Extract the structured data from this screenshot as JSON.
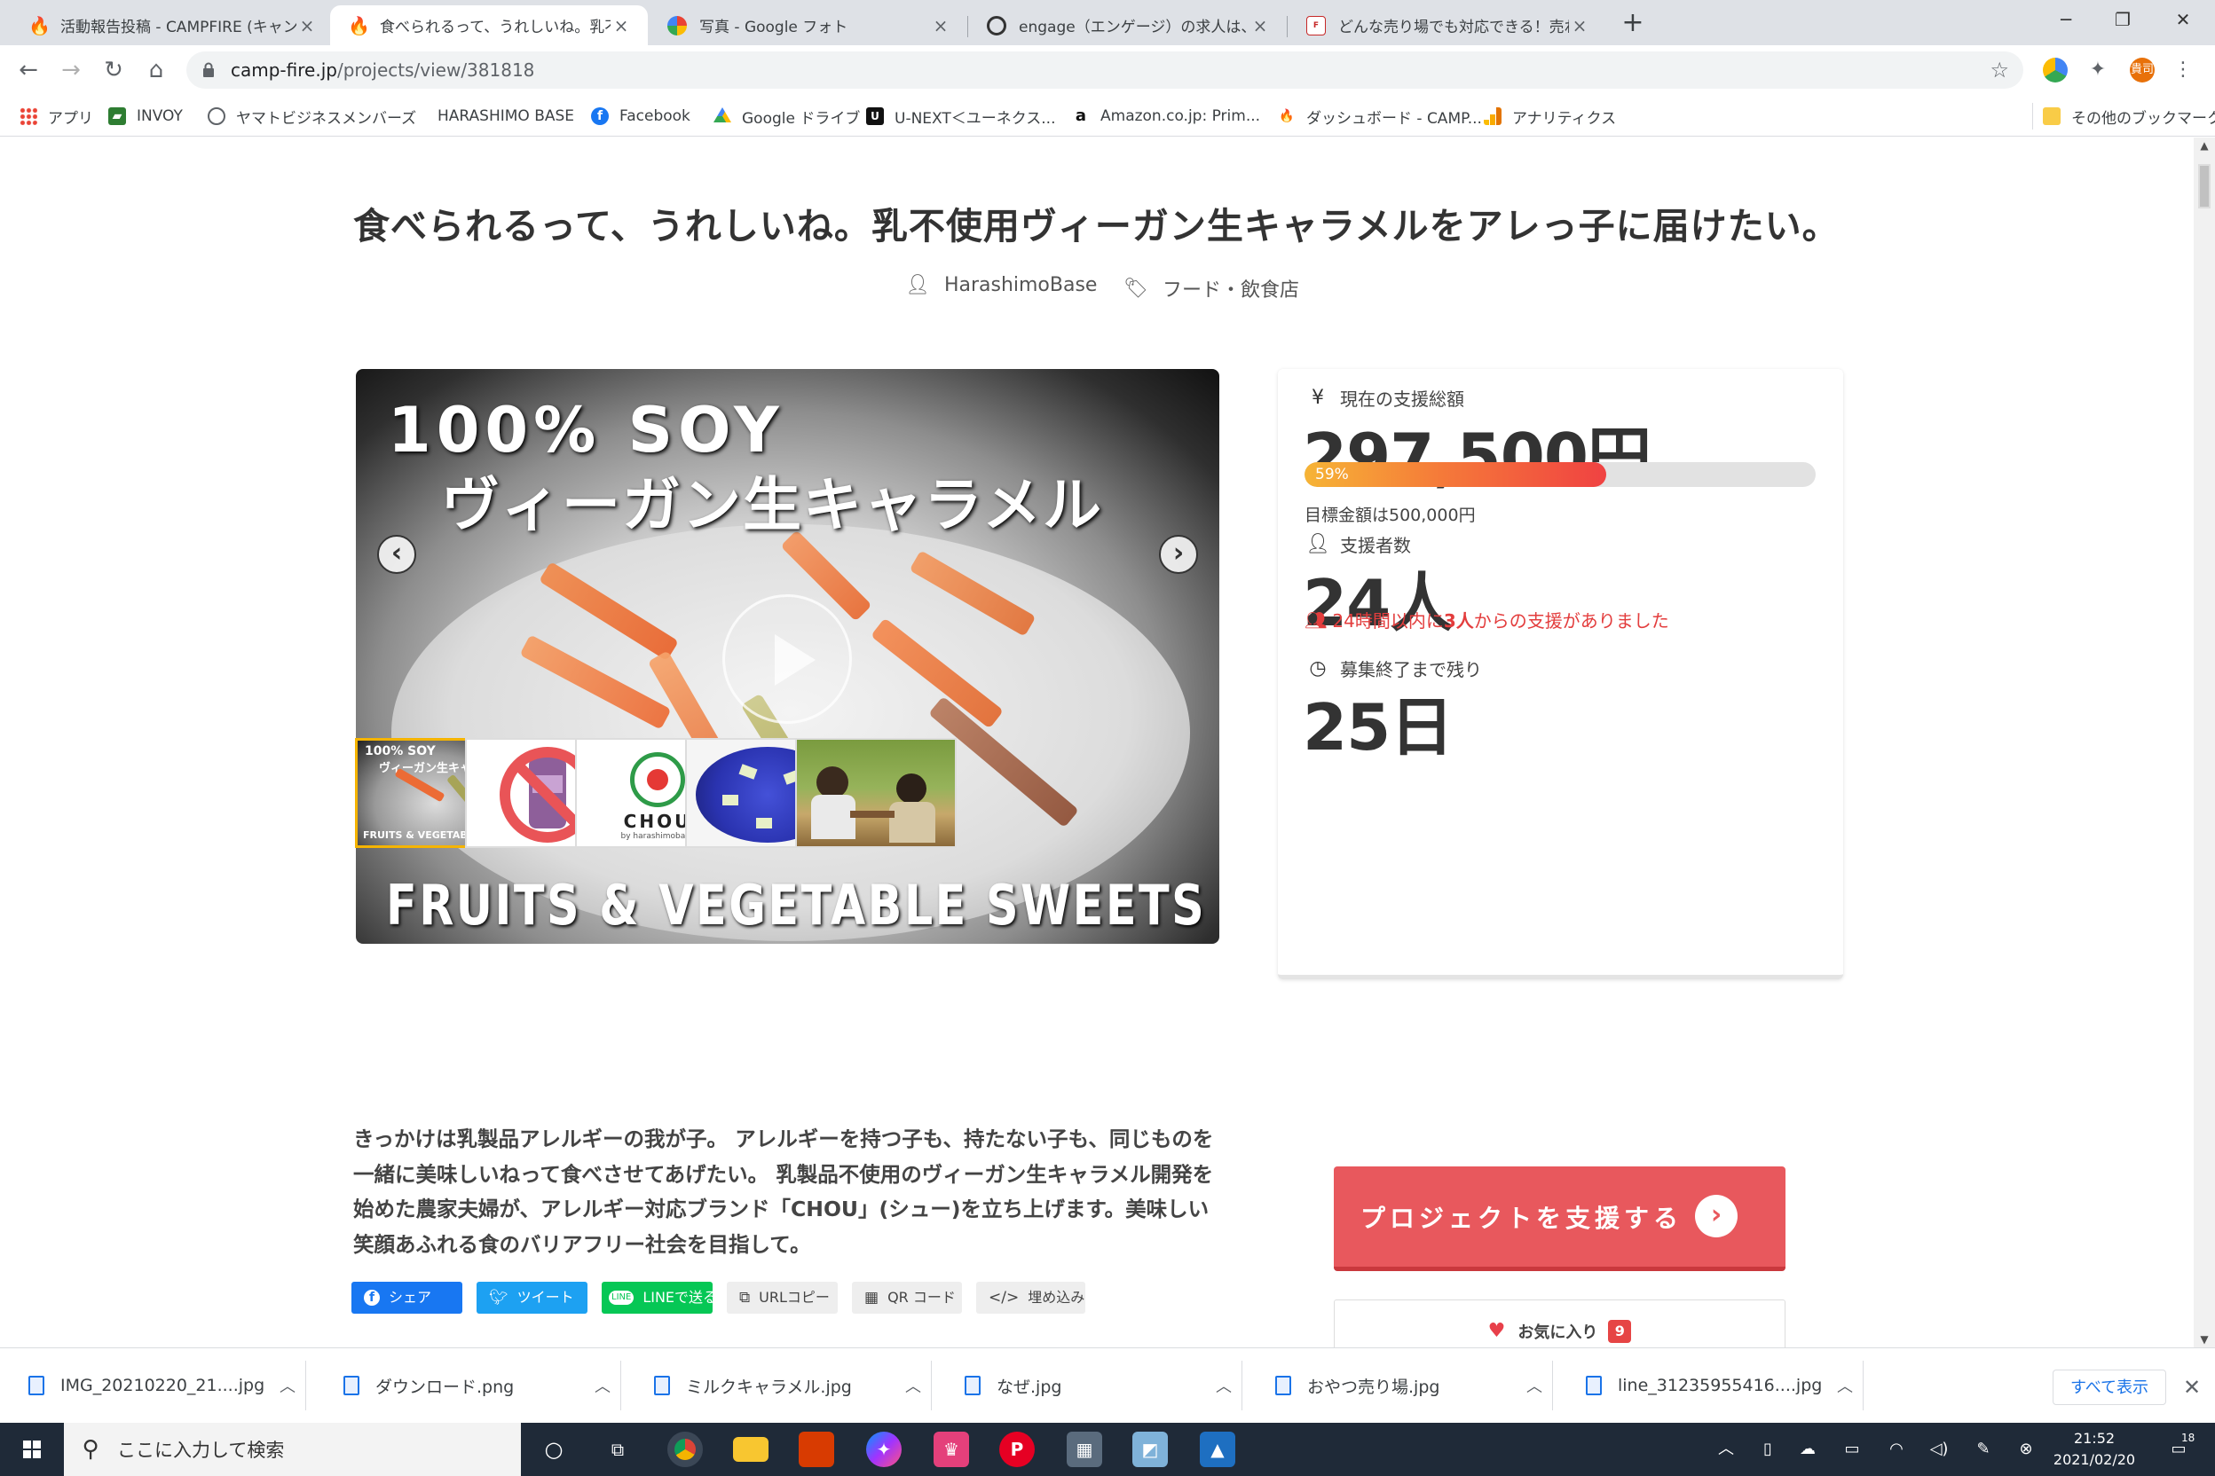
{
  "browser": {
    "tabs": [
      {
        "title": "活動報告投稿 - CAMPFIRE (キャン",
        "active": false
      },
      {
        "title": "食べられるって、うれしいね。乳不使用",
        "active": true
      },
      {
        "title": "写真 - Google フォト",
        "active": false
      },
      {
        "title": "engage（エンゲージ）の求人は、な",
        "active": false
      },
      {
        "title": "どんな売り場でも対応できる！売れる",
        "active": false
      }
    ],
    "new_tab": "+",
    "url_host": "camp-fire.jp",
    "url_path": "/projects/view/381818",
    "profile_label": "貴司",
    "bookmarks": [
      "アプリ",
      "INVOY",
      "ヤマトビジネスメンバーズ",
      "HARASHIMO BASE",
      "Facebook",
      "Google ドライブ",
      "U-NEXT＜ユーネクス...",
      "Amazon.co.jp: Prim...",
      "ダッシュボード - CAMP...",
      "アナリティクス"
    ],
    "other_bookmarks": "その他のブックマーク"
  },
  "project": {
    "title": "食べられるって、うれしいね。乳不使用ヴィーガン生キャラメルをアレっ子に届けたい。",
    "owner": "HarashimoBase",
    "category": "フード・飲食店",
    "hero_text_1": "100% SOY",
    "hero_text_2": "ヴィーガン生キャラメル",
    "hero_text_3": "FRUITS & VEGETABLE SWEETS",
    "thumb1_text_1": "100% SOY",
    "thumb1_text_2": "ヴィーガン生キャラメル",
    "thumb1_text_3": "FRUITS & VEGETABLE SWEETS",
    "thumb3_brand": "CHOU",
    "thumb3_sub": "by harashimobase",
    "description": "きっかけは乳製品アレルギーの我が子。 アレルギーを持つ子も、持たない子も、同じものを一緒に美味しいねって食べさせてあげたい。 乳製品不使用のヴィーガン生キャラメル開発を始めた農家夫婦が、アレルギー対応ブランド「CHOU」(シュー)を立ち上げます。美味しい笑顔あふれる食のバリアフリー社会を目指して。",
    "share": {
      "facebook": "シェア",
      "twitter": "ツイート",
      "line": "LINEで送る",
      "url_copy": "URLコピー",
      "qr": "QR コード",
      "embed": "埋め込み"
    }
  },
  "stats": {
    "amount_label": "現在の支援総額",
    "amount": "297,500円",
    "progress_percent": 59,
    "progress_label": "59%",
    "goal_text": "目標金額は500,000円",
    "supporters_label": "支援者数",
    "supporters": "24人",
    "recent_prefix": "24時間以内に",
    "recent_count": "3人",
    "recent_suffix": "からの支援がありました",
    "remaining_label": "募集終了まで残り",
    "remaining": "25日"
  },
  "actions": {
    "support_button": "プロジェクトを支援する",
    "favorite_button": "お気に入り",
    "favorite_count": "9"
  },
  "downloads": {
    "items": [
      "IMG_20210220_21....jpg",
      "ダウンロード.png",
      "ミルクキャラメル.jpg",
      "なぜ.jpg",
      "おやつ売り場.jpg",
      "line_31235955416....jpg"
    ],
    "show_all": "すべて表示"
  },
  "taskbar": {
    "search_placeholder": "ここに入力して検索",
    "time": "21:52",
    "date": "2021/02/20",
    "notification_count": "18"
  },
  "colors": {
    "accent_red": "#e8585d",
    "progress_start": "#f6b436",
    "progress_end": "#f04242",
    "recent_red": "#e33d3d"
  }
}
